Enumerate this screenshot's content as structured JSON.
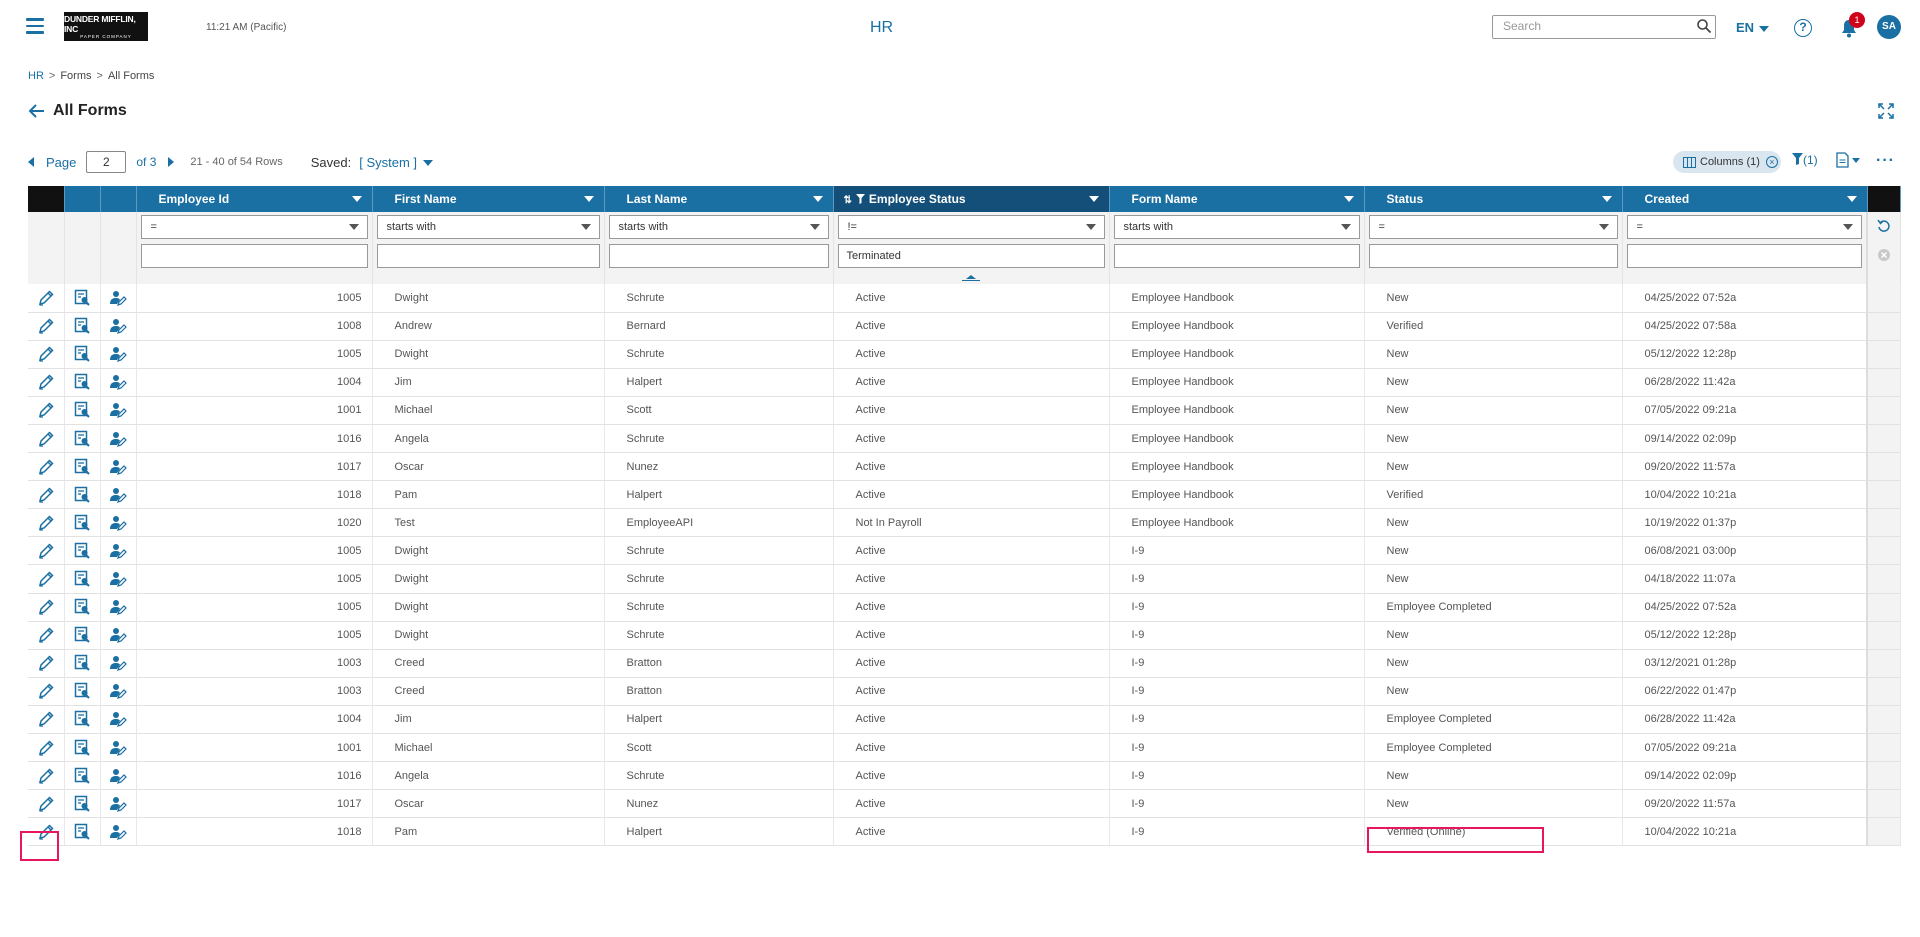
{
  "header": {
    "logo_line1": "DUNDER MIFFLIN, INC",
    "logo_line2": "PAPER COMPANY",
    "clock": "11:21 AM (Pacific)",
    "app_title": "HR",
    "search_placeholder": "Search",
    "language": "EN",
    "help_label": "?",
    "notification_count": "1",
    "avatar_initials": "SA"
  },
  "breadcrumb": [
    "HR",
    "Forms",
    "All Forms"
  ],
  "page": {
    "title": "All Forms"
  },
  "pager": {
    "label": "Page",
    "current": "2",
    "of_text": "of 3",
    "rows_text": "21 - 40 of 54 Rows",
    "saved_label": "Saved:",
    "saved_value": "[ System ]"
  },
  "toolbar": {
    "columns_chip": "Columns (1)",
    "filter_count": "(1)"
  },
  "columns": [
    "Employee Id",
    "First Name",
    "Last Name",
    "Employee Status",
    "Form Name",
    "Status",
    "Created"
  ],
  "filters": {
    "operators": [
      "=",
      "starts with",
      "starts with",
      "!=",
      "starts with",
      "=",
      "="
    ],
    "values": [
      "",
      "",
      "",
      "Terminated",
      "",
      "",
      ""
    ]
  },
  "rows": [
    [
      "1005",
      "Dwight",
      "Schrute",
      "Active",
      "Employee Handbook",
      "New",
      "04/25/2022 07:52a"
    ],
    [
      "1008",
      "Andrew",
      "Bernard",
      "Active",
      "Employee Handbook",
      "Verified",
      "04/25/2022 07:58a"
    ],
    [
      "1005",
      "Dwight",
      "Schrute",
      "Active",
      "Employee Handbook",
      "New",
      "05/12/2022 12:28p"
    ],
    [
      "1004",
      "Jim",
      "Halpert",
      "Active",
      "Employee Handbook",
      "New",
      "06/28/2022 11:42a"
    ],
    [
      "1001",
      "Michael",
      "Scott",
      "Active",
      "Employee Handbook",
      "New",
      "07/05/2022 09:21a"
    ],
    [
      "1016",
      "Angela",
      "Schrute",
      "Active",
      "Employee Handbook",
      "New",
      "09/14/2022 02:09p"
    ],
    [
      "1017",
      "Oscar",
      "Nunez",
      "Active",
      "Employee Handbook",
      "New",
      "09/20/2022 11:57a"
    ],
    [
      "1018",
      "Pam",
      "Halpert",
      "Active",
      "Employee Handbook",
      "Verified",
      "10/04/2022 10:21a"
    ],
    [
      "1020",
      "Test",
      "EmployeeAPI",
      "Not In Payroll",
      "Employee Handbook",
      "New",
      "10/19/2022 01:37p"
    ],
    [
      "1005",
      "Dwight",
      "Schrute",
      "Active",
      "I-9",
      "New",
      "06/08/2021 03:00p"
    ],
    [
      "1005",
      "Dwight",
      "Schrute",
      "Active",
      "I-9",
      "New",
      "04/18/2022 11:07a"
    ],
    [
      "1005",
      "Dwight",
      "Schrute",
      "Active",
      "I-9",
      "Employee Completed",
      "04/25/2022 07:52a"
    ],
    [
      "1005",
      "Dwight",
      "Schrute",
      "Active",
      "I-9",
      "New",
      "05/12/2022 12:28p"
    ],
    [
      "1003",
      "Creed",
      "Bratton",
      "Active",
      "I-9",
      "New",
      "03/12/2021 01:28p"
    ],
    [
      "1003",
      "Creed",
      "Bratton",
      "Active",
      "I-9",
      "New",
      "06/22/2022 01:47p"
    ],
    [
      "1004",
      "Jim",
      "Halpert",
      "Active",
      "I-9",
      "Employee Completed",
      "06/28/2022 11:42a"
    ],
    [
      "1001",
      "Michael",
      "Scott",
      "Active",
      "I-9",
      "Employee Completed",
      "07/05/2022 09:21a"
    ],
    [
      "1016",
      "Angela",
      "Schrute",
      "Active",
      "I-9",
      "New",
      "09/14/2022 02:09p"
    ],
    [
      "1017",
      "Oscar",
      "Nunez",
      "Active",
      "I-9",
      "New",
      "09/20/2022 11:57a"
    ],
    [
      "1018",
      "Pam",
      "Halpert",
      "Active",
      "I-9",
      "Verified (Online)",
      "10/04/2022 10:21a"
    ]
  ],
  "colors": {
    "primary": "#1a6fa3",
    "header_sorted": "#134f78",
    "highlight": "#e8175d",
    "badge": "#d0021b"
  },
  "icons": [
    "menu-icon",
    "search-icon",
    "help-icon",
    "bell-icon",
    "back-arrow-icon",
    "expand-icon",
    "columns-icon",
    "filter-icon",
    "export-icon",
    "more-icon",
    "edit-pencil-icon",
    "form-view-icon",
    "employee-edit-icon",
    "reset-filters-icon",
    "clear-filters-icon"
  ]
}
